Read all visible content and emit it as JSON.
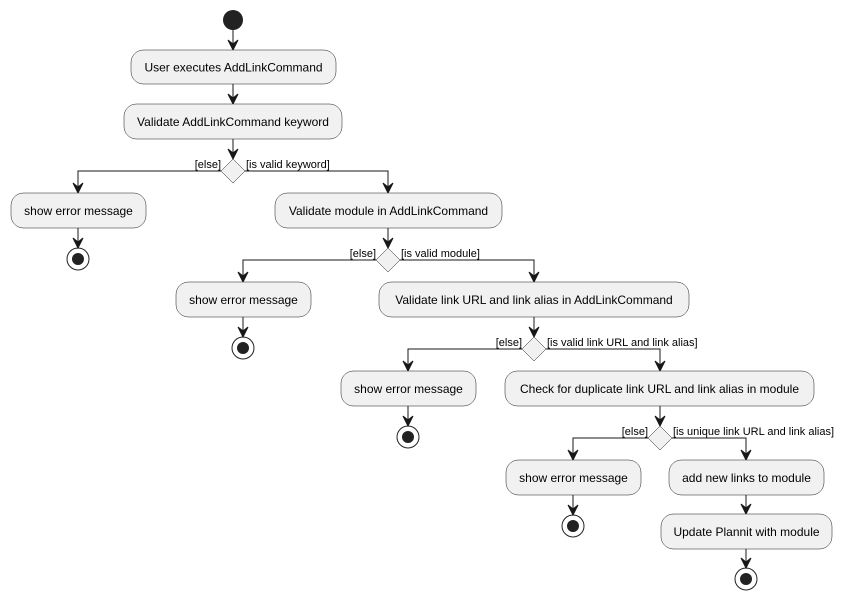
{
  "diagram": {
    "type": "activity",
    "start": {
      "id": "start"
    },
    "actions": [
      {
        "id": "a1",
        "label": "User executes AddLinkCommand"
      },
      {
        "id": "a2",
        "label": "Validate AddLinkCommand keyword"
      },
      {
        "id": "e1",
        "label": "show error message"
      },
      {
        "id": "a3",
        "label": "Validate module in AddLinkCommand"
      },
      {
        "id": "e2",
        "label": "show error message"
      },
      {
        "id": "a4",
        "label": "Validate link URL and link alias in AddLinkCommand"
      },
      {
        "id": "e3",
        "label": "show error message"
      },
      {
        "id": "a5",
        "label": "Check for duplicate link URL and link alias in module"
      },
      {
        "id": "e4",
        "label": "show error message"
      },
      {
        "id": "a6",
        "label": "add new links to module"
      },
      {
        "id": "a7",
        "label": "Update Plannit with module"
      }
    ],
    "decisions": [
      {
        "id": "d1",
        "else_label": "[else]",
        "then_label": "[is valid keyword]"
      },
      {
        "id": "d2",
        "else_label": "[else]",
        "then_label": "[is valid module]"
      },
      {
        "id": "d3",
        "else_label": "[else]",
        "then_label": "[is valid link URL and link alias]"
      },
      {
        "id": "d4",
        "else_label": "[else]",
        "then_label": "[is unique link URL and link alias]"
      }
    ],
    "ends": [
      "end1",
      "end2",
      "end3",
      "end4",
      "end5"
    ],
    "edges": [
      [
        "start",
        "a1"
      ],
      [
        "a1",
        "a2"
      ],
      [
        "a2",
        "d1"
      ],
      [
        "d1",
        "e1",
        "[else]"
      ],
      [
        "d1",
        "a3",
        "[is valid keyword]"
      ],
      [
        "e1",
        "end1"
      ],
      [
        "a3",
        "d2"
      ],
      [
        "d2",
        "e2",
        "[else]"
      ],
      [
        "d2",
        "a4",
        "[is valid module]"
      ],
      [
        "e2",
        "end2"
      ],
      [
        "a4",
        "d3"
      ],
      [
        "d3",
        "e3",
        "[else]"
      ],
      [
        "d3",
        "a5",
        "[is valid link URL and link alias]"
      ],
      [
        "e3",
        "end3"
      ],
      [
        "a5",
        "d4"
      ],
      [
        "d4",
        "e4",
        "[else]"
      ],
      [
        "d4",
        "a6",
        "[is unique link URL and link alias]"
      ],
      [
        "e4",
        "end4"
      ],
      [
        "a6",
        "a7"
      ],
      [
        "a7",
        "end5"
      ]
    ]
  }
}
